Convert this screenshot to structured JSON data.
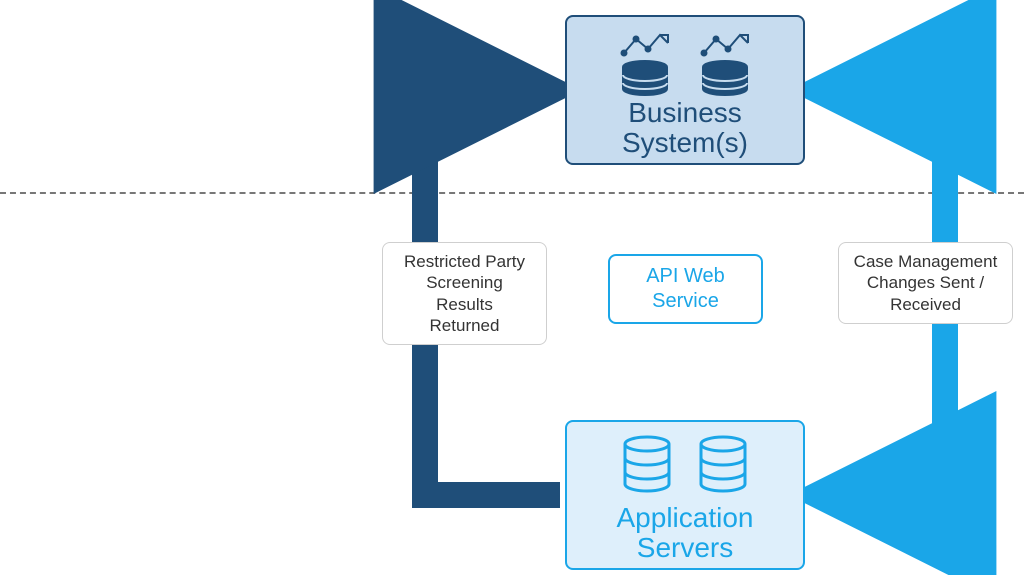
{
  "top_box": {
    "title": "Business\nSystem(s)"
  },
  "bottom_box": {
    "title": "Application\nServers"
  },
  "center_label": "API Web\nService",
  "left_note": "Restricted Party\nScreening\nResults\nReturned",
  "right_note": "Case Management\nChanges Sent /\nReceived",
  "colors": {
    "dark": "#1f4e79",
    "light": "#1aa6e8"
  }
}
